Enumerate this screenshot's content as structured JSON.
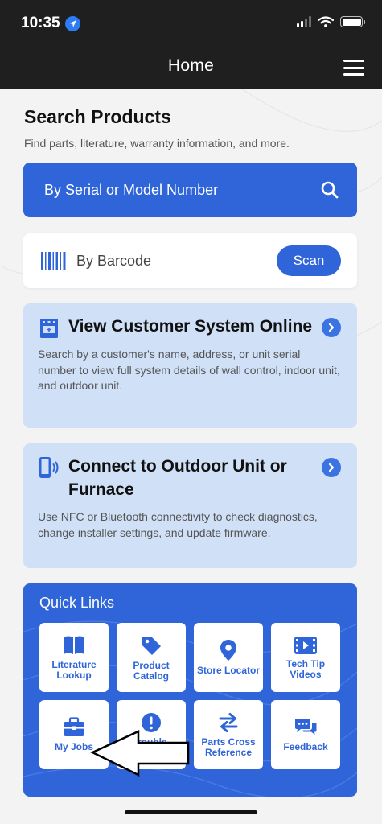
{
  "status_bar": {
    "time": "10:35"
  },
  "header": {
    "title": "Home"
  },
  "search": {
    "title": "Search Products",
    "subtitle": "Find parts, literature, warranty information, and more.",
    "serial_placeholder": "By Serial or Model Number",
    "barcode_label": "By Barcode",
    "scan_label": "Scan"
  },
  "cards": [
    {
      "title": "View Customer System Online",
      "description": "Search by a customer's name, address, or unit serial number to view full system details of wall control, indoor unit, and outdoor unit."
    },
    {
      "title": "Connect to Outdoor Unit or Furnace",
      "description": "Use NFC or Bluetooth connectivity to check diagnostics, change installer settings, and update firmware."
    }
  ],
  "quick_links": {
    "title": "Quick Links",
    "items": [
      {
        "label": "Literature Lookup",
        "icon": "book-icon"
      },
      {
        "label": "Product Catalog",
        "icon": "tag-icon"
      },
      {
        "label": "Store Locator",
        "icon": "location-pin-icon"
      },
      {
        "label": "Tech Tip Videos",
        "icon": "video-icon"
      },
      {
        "label": "My Jobs",
        "icon": "briefcase-icon"
      },
      {
        "label": "Trouble-shooting",
        "icon": "alert-circle-icon"
      },
      {
        "label": "Parts Cross Reference",
        "icon": "swap-arrows-icon"
      },
      {
        "label": "Feedback",
        "icon": "chat-bubbles-icon"
      }
    ]
  },
  "colors": {
    "primary": "#2f65d9",
    "card_bg": "#cfe0f7",
    "topbar": "#1f1f1f"
  }
}
